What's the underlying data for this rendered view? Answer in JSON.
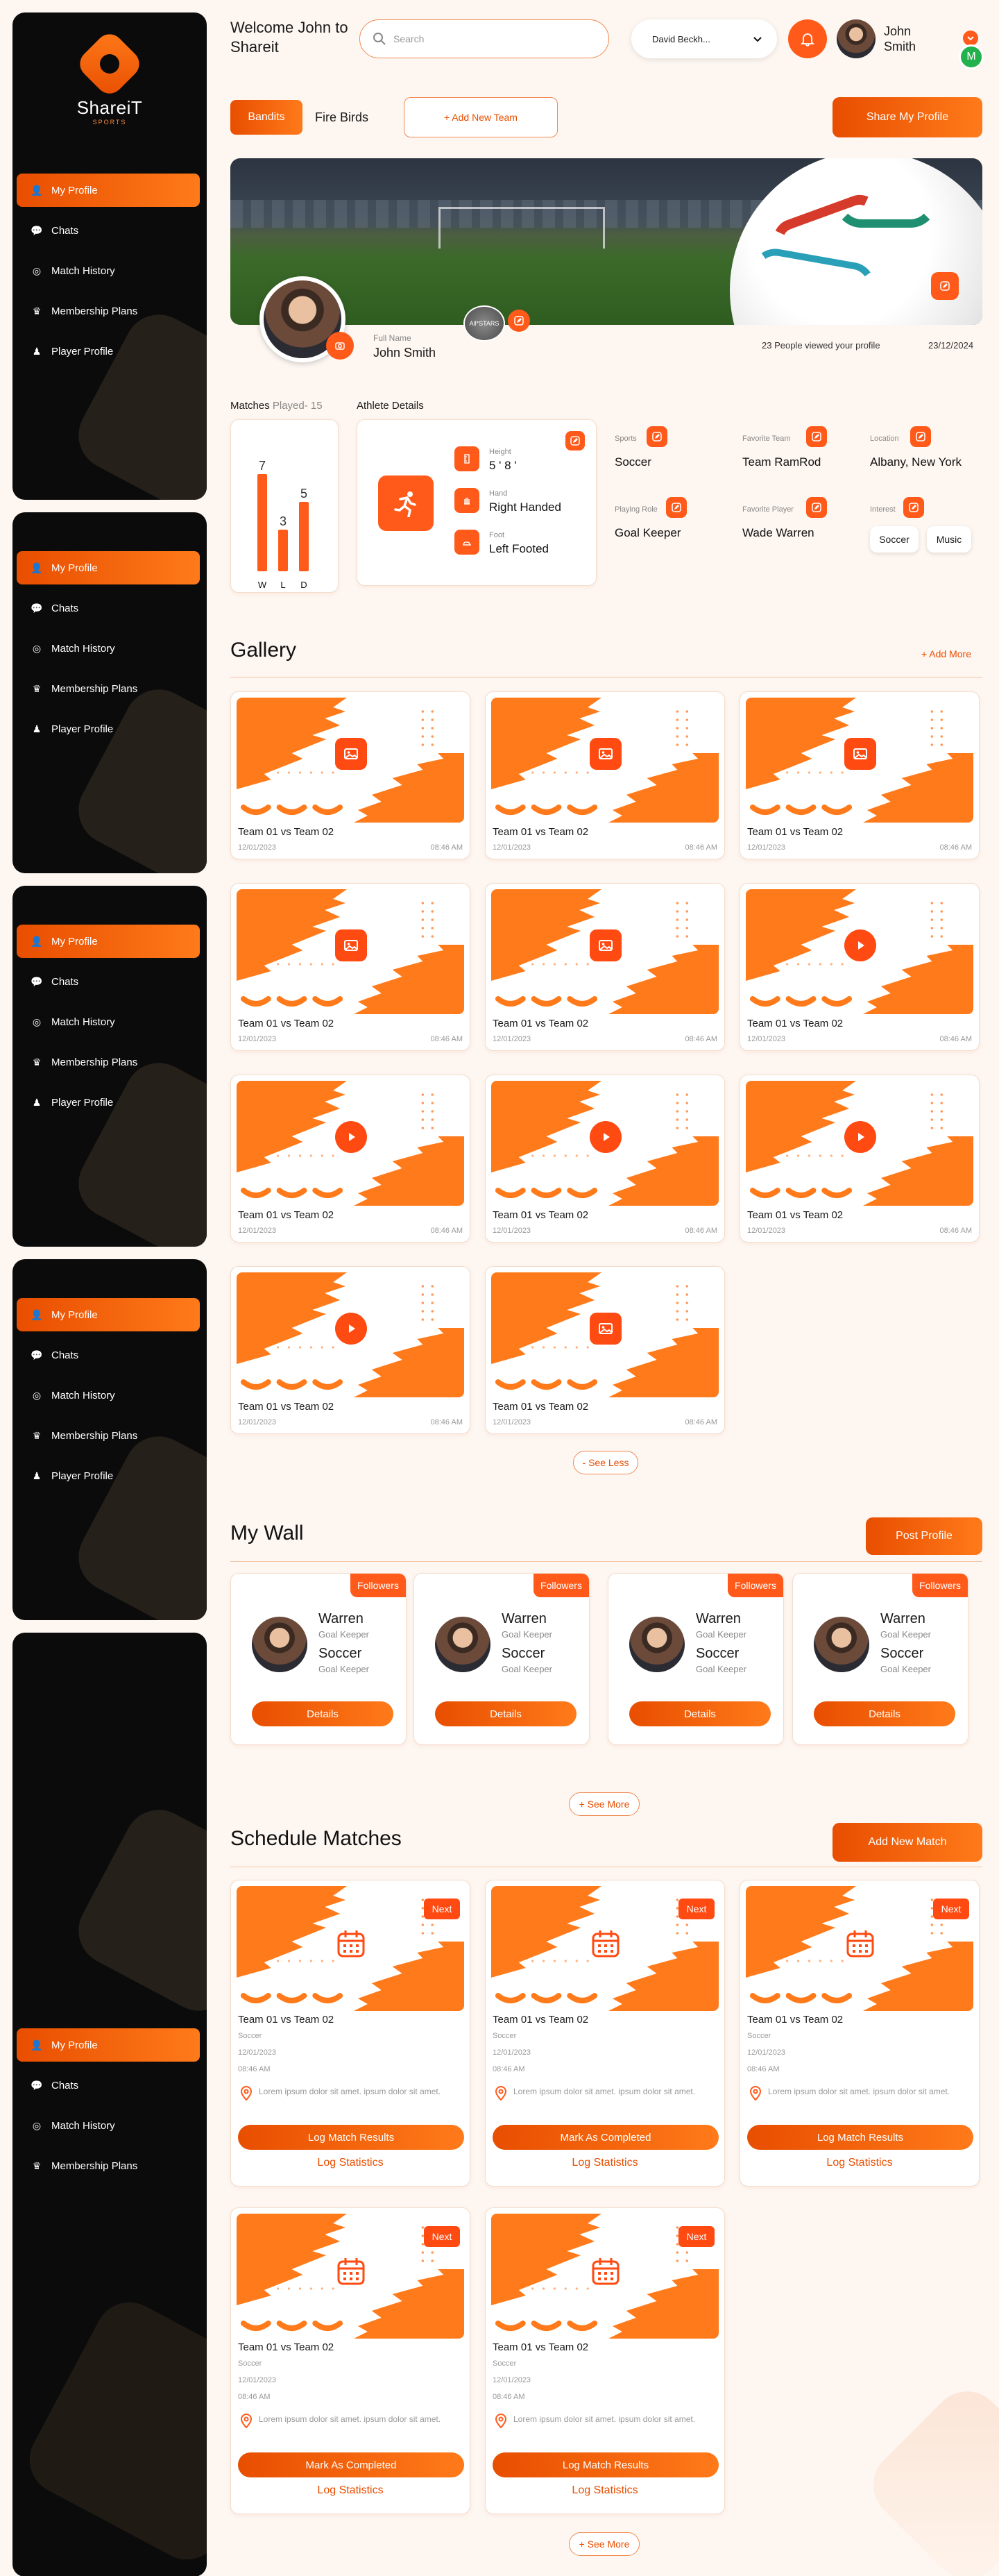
{
  "app": {
    "name": "ShareiT",
    "sub": "SPORTS"
  },
  "nav": [
    "My Profile",
    "Chats",
    "Match History",
    "Membership Plans",
    "Player Profile"
  ],
  "header": {
    "welcome": "Welcome John to Shareit",
    "search_placeholder": "Search",
    "account_select": "David Beckh...",
    "user_name": "John Smith",
    "user_initial": "M"
  },
  "teams": {
    "tabs": [
      "Bandits",
      "Fire Birds"
    ],
    "add": "+ Add New Team",
    "share": "Share My Profile"
  },
  "profile": {
    "full_name_label": "Full Name",
    "full_name": "John Smith",
    "badge": "All*STARS",
    "views": "23 People viewed your profile",
    "date": "23/12/2024"
  },
  "matches": {
    "label": "Matches",
    "played": "Played- 15",
    "bars": [
      {
        "label": "W",
        "value": 7
      },
      {
        "label": "L",
        "value": 3
      },
      {
        "label": "D",
        "value": 5
      }
    ]
  },
  "athlete": {
    "title": "Athlete Details",
    "height_label": "Height",
    "height": "5 ' 8 '",
    "hand_label": "Hand",
    "hand": "Right Handed",
    "foot_label": "Foot",
    "foot": "Left Footed"
  },
  "details": {
    "sports_label": "Sports",
    "sports": "Soccer",
    "team_label": "Favorite Team",
    "team": "Team RamRod",
    "location_label": "Location",
    "location": "Albany, New York",
    "role_label": "Playing Role",
    "role": "Goal Keeper",
    "player_label": "Favorite Player",
    "player": "Wade Warren",
    "interest_label": "Interest",
    "interests": [
      "Soccer",
      "Music"
    ]
  },
  "gallery": {
    "title": "Gallery",
    "add": "+ Add More",
    "less": "- See Less",
    "item_title": "Team 01 vs Team 02",
    "item_date": "12/01/2023",
    "item_time": "08:46 AM",
    "types": [
      "image",
      "image",
      "image",
      "image",
      "image",
      "video",
      "video",
      "video",
      "video",
      "video",
      "image"
    ]
  },
  "wall": {
    "title": "My Wall",
    "post": "Post Profile",
    "followers": "Followers",
    "name": "Warren",
    "role": "Goal Keeper",
    "sport": "Soccer",
    "details": "Details",
    "more": "+ See More"
  },
  "schedule": {
    "title": "Schedule Matches",
    "add": "Add New Match",
    "next": "Next",
    "match": "Team 01 vs Team 02",
    "sport": "Soccer",
    "date": "12/01/2023",
    "time": "08:46 AM",
    "location": "Lorem ipsum dolor sit amet. ipsum dolor sit amet.",
    "log_stats": "Log Statistics",
    "actions": [
      "Log Match Results",
      "Mark As Completed",
      "Log Match Results",
      "Mark As Completed",
      "Log Match Results"
    ],
    "more": "+ See More"
  },
  "colors": {
    "accent": "#ff5a1a",
    "accent_dark": "#e84e00",
    "sidebar": "#0b0b0b",
    "page": "#fdf6f1"
  }
}
